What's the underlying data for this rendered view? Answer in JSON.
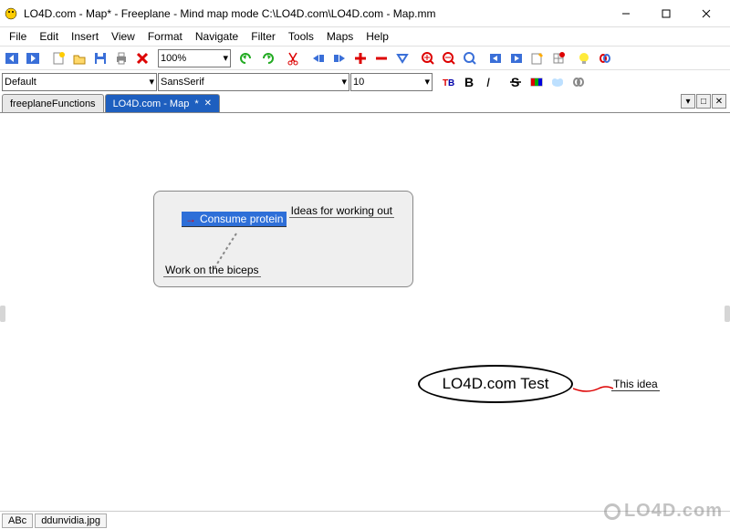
{
  "window": {
    "title": "LO4D.com - Map* - Freeplane - Mind map mode C:\\LO4D.com\\LO4D.com - Map.mm"
  },
  "menu": {
    "items": [
      "File",
      "Edit",
      "Insert",
      "View",
      "Format",
      "Navigate",
      "Filter",
      "Tools",
      "Maps",
      "Help"
    ]
  },
  "toolbar": {
    "zoom": "100%"
  },
  "format_bar": {
    "style": "Default",
    "font": "SansSerif",
    "size": "10"
  },
  "tabs": {
    "items": [
      {
        "label": "freeplaneFunctions",
        "active": false,
        "dirty": false
      },
      {
        "label": "LO4D.com - Map",
        "active": true,
        "dirty": true
      }
    ]
  },
  "mindmap": {
    "selected_node": "Consume protein",
    "child_top": "Ideas for working out",
    "child_bottom": "Work on the biceps",
    "ellipse": "LO4D.com Test",
    "ellipse_child": "This idea"
  },
  "statusbar": {
    "mode_label": "ABc",
    "filename": "ddunvidia.jpg"
  },
  "watermark": "LO4D.com"
}
